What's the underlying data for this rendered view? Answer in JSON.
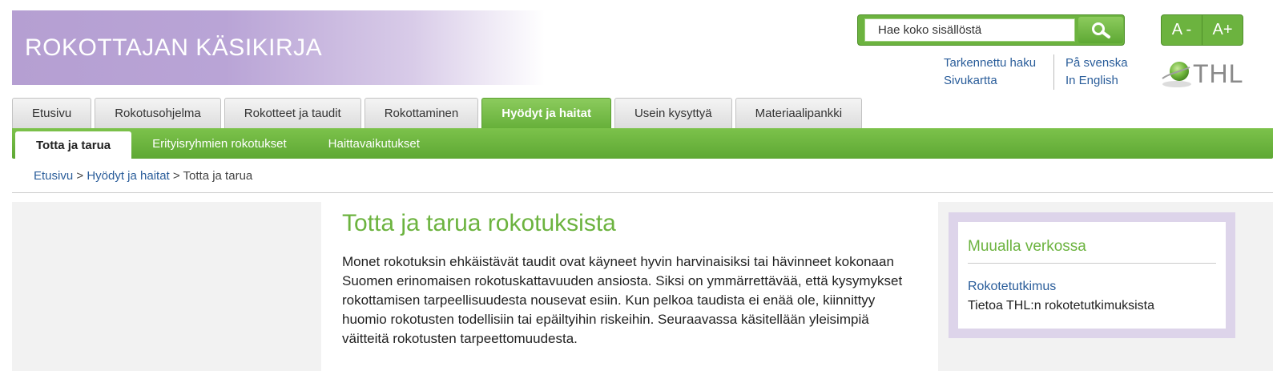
{
  "header": {
    "site_title": "ROKOTTAJAN KÄSIKIRJA"
  },
  "search": {
    "placeholder": "Hae koko sisällöstä",
    "button_icon": "search-icon"
  },
  "font_size": {
    "decrease_label": "A -",
    "increase_label": "A+"
  },
  "top_links": {
    "advanced_search": "Tarkennettu haku",
    "sitemap": "Sivukartta",
    "swedish": "På svenska",
    "english": "In English"
  },
  "logo": {
    "text": "THL",
    "icon": "globe-icon"
  },
  "main_tabs": [
    {
      "label": "Etusivu",
      "active": false
    },
    {
      "label": "Rokotusohjelma",
      "active": false
    },
    {
      "label": "Rokotteet ja taudit",
      "active": false
    },
    {
      "label": "Rokottaminen",
      "active": false
    },
    {
      "label": "Hyödyt ja haitat",
      "active": true
    },
    {
      "label": "Usein kysyttyä",
      "active": false
    },
    {
      "label": "Materiaalipankki",
      "active": false
    }
  ],
  "sub_nav": [
    {
      "label": "Totta ja tarua",
      "active": true
    },
    {
      "label": "Erityisryhmien rokotukset",
      "active": false
    },
    {
      "label": "Haittavaikutukset",
      "active": false
    }
  ],
  "breadcrumb": {
    "items": [
      "Etusivu",
      "Hyödyt ja haitat"
    ],
    "current": "Totta ja tarua",
    "separator": ">"
  },
  "main": {
    "title": "Totta ja tarua rokotuksista",
    "intro": "Monet rokotuksin ehkäistävät taudit ovat käyneet hyvin harvinaisiksi tai hävinneet kokonaan Suomen erinomaisen rokotuskattavuuden ansiosta. Siksi on ymmärrettävää, että kysymykset rokottamisen tarpeellisuudesta nousevat esiin. Kun pelkoa taudista ei enää ole, kiinnittyy huomio rokotusten todellisiin tai epäiltyihin riskeihin. Seuraavassa käsitellään yleisimpiä väitteitä rokotusten tarpeettomuudesta."
  },
  "sidebar": {
    "title": "Muualla verkossa",
    "link": "Rokotetutkimus",
    "description": "Tietoa THL:n rokotetutkimuksista"
  },
  "colors": {
    "green": "#6cb33f",
    "purple": "#b59fd2",
    "link": "#2a5d9a"
  }
}
